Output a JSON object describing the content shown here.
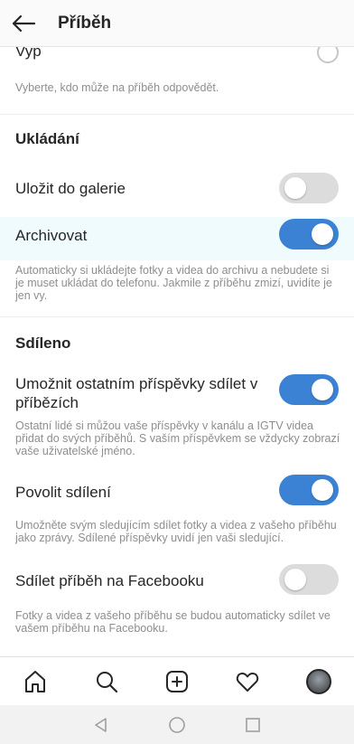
{
  "header": {
    "title": "Příběh"
  },
  "reply": {
    "option_label": "Vyp",
    "description": "Vyberte, kdo může na příběh odpovědět."
  },
  "saving": {
    "section_title": "Ukládání",
    "save_to_gallery": {
      "label": "Uložit do galerie",
      "enabled": false
    },
    "archive": {
      "label": "Archivovat",
      "enabled": true,
      "description": "Automaticky si ukládejte fotky a videa do archivu a nebudete si je muset ukládat do telefonu. Jakmile z příběhu zmizí, uvidíte je jen vy."
    }
  },
  "sharing": {
    "section_title": "Sdíleno",
    "allow_resharing": {
      "label": "Umožnit ostatním příspěvky sdílet v příbězích",
      "enabled": true,
      "description": "Ostatní lidé si můžou vaše příspěvky v kanálu a IGTV videa přidat do svých příběhů. S vaším příspěvkem se vždycky zobrazí vaše uživatelské jméno."
    },
    "allow_sharing": {
      "label": "Povolit sdílení",
      "enabled": true,
      "description": "Umožněte svým sledujícím sdílet fotky a videa z vašeho příběhu jako zprávy. Sdílené příspěvky uvidí jen vaši sledující."
    },
    "share_to_facebook": {
      "label": "Sdílet příběh na Facebooku",
      "enabled": false,
      "description": "Fotky a videa z vašeho příběhu se budou automaticky sdílet ve vašem příběhu na Facebooku."
    }
  },
  "colors": {
    "toggle_on": "#3b82d4",
    "toggle_off": "#dcdcdc",
    "highlight": "#f0fbfe",
    "secondary_text": "#8e8e8e"
  },
  "icons": {
    "back": "arrow-left-icon",
    "home": "home-icon",
    "search": "search-icon",
    "add": "plus-square-icon",
    "activity": "heart-icon",
    "profile": "avatar",
    "nav_back": "triangle-back-icon",
    "nav_home": "circle-home-icon",
    "nav_recents": "square-recents-icon"
  }
}
